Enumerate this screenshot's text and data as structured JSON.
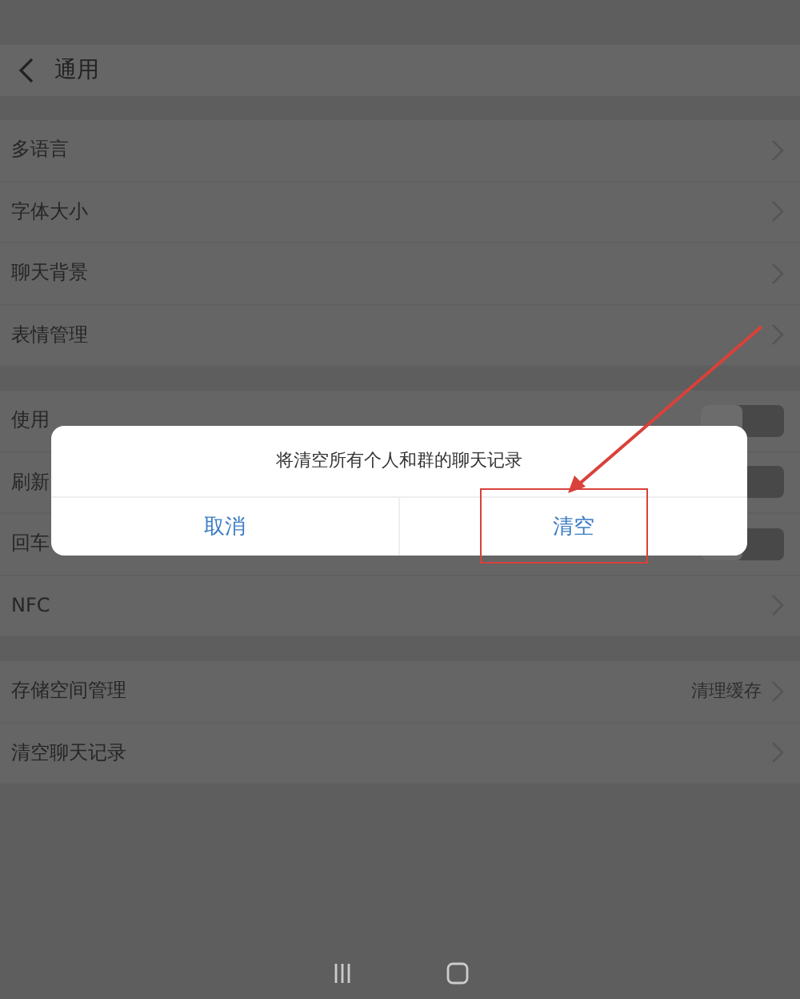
{
  "header": {
    "title": "通用"
  },
  "sections": [
    {
      "items": [
        {
          "kind": "link",
          "label": "多语言"
        },
        {
          "kind": "link",
          "label": "字体大小"
        },
        {
          "kind": "link",
          "label": "聊天背景"
        },
        {
          "kind": "link",
          "label": "表情管理"
        }
      ]
    },
    {
      "items": [
        {
          "kind": "toggle",
          "label": "使用",
          "on": false
        },
        {
          "kind": "toggle",
          "label": "刷新",
          "on": false
        },
        {
          "kind": "toggle",
          "label": "回车",
          "on": false
        },
        {
          "kind": "link",
          "label": "NFC"
        }
      ]
    },
    {
      "items": [
        {
          "kind": "link",
          "label": "存储空间管理",
          "value": "清理缓存"
        },
        {
          "kind": "link",
          "label": "清空聊天记录"
        }
      ]
    }
  ],
  "dialog": {
    "message": "将清空所有个人和群的聊天记录",
    "buttons": [
      {
        "label": "取消",
        "highlighted": false
      },
      {
        "label": "清空",
        "highlighted": true
      }
    ]
  }
}
